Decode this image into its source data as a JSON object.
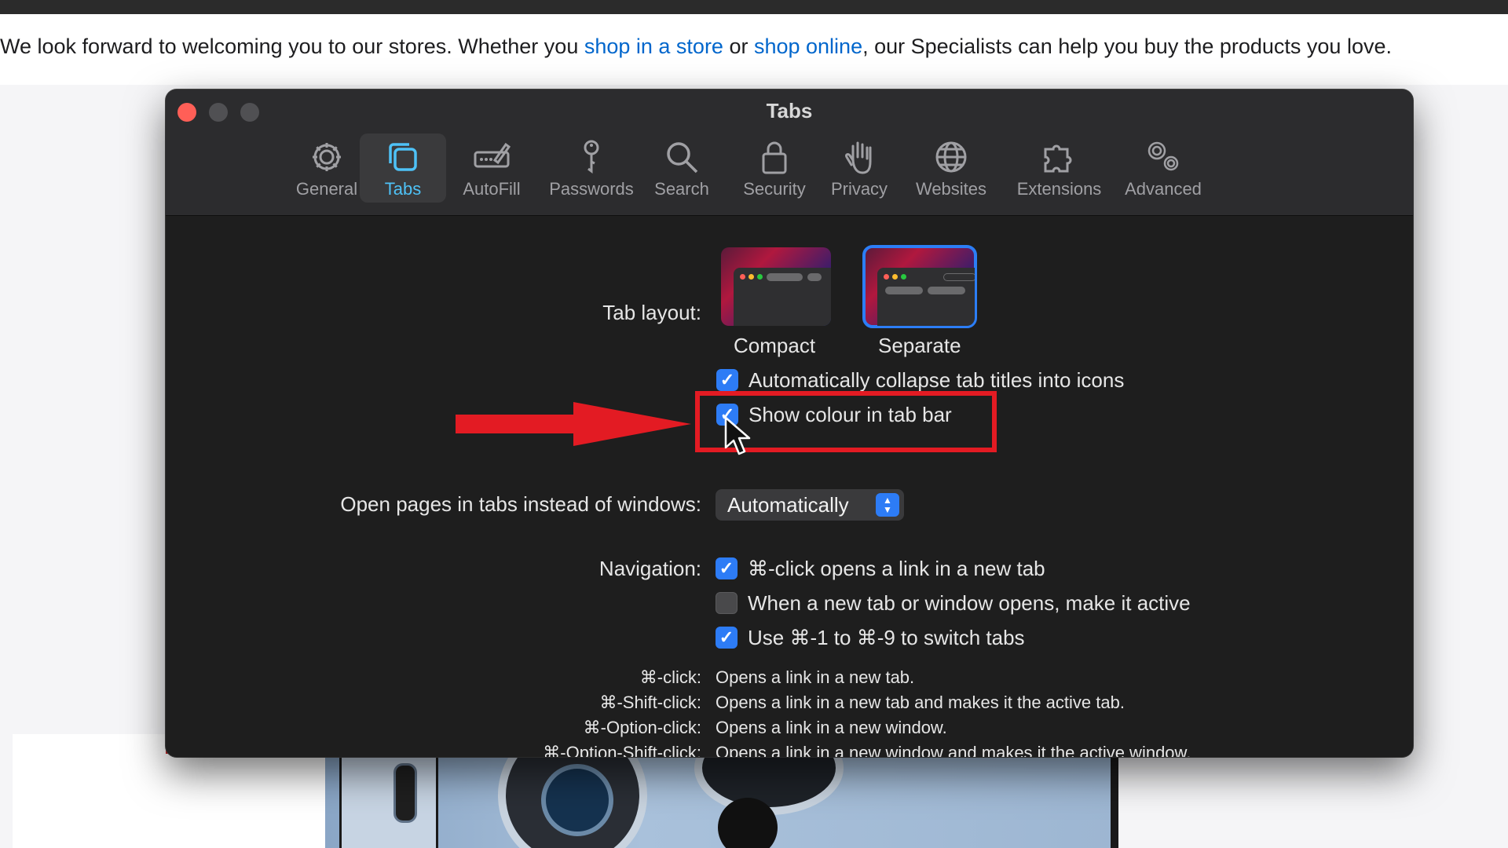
{
  "banner": {
    "prefix": "We look forward to welcoming you to our stores. Whether you ",
    "link1": "shop in a store",
    "middle": " or ",
    "link2": "shop online",
    "suffix": ", our Specialists can help you buy the products you love."
  },
  "window": {
    "title": "Tabs",
    "toolbar": [
      {
        "label": "General",
        "icon": "gear-icon"
      },
      {
        "label": "Tabs",
        "icon": "tabs-icon",
        "active": true
      },
      {
        "label": "AutoFill",
        "icon": "autofill-icon"
      },
      {
        "label": "Passwords",
        "icon": "key-icon"
      },
      {
        "label": "Search",
        "icon": "search-icon"
      },
      {
        "label": "Security",
        "icon": "lock-icon"
      },
      {
        "label": "Privacy",
        "icon": "hand-icon"
      },
      {
        "label": "Websites",
        "icon": "globe-icon"
      },
      {
        "label": "Extensions",
        "icon": "puzzle-icon"
      },
      {
        "label": "Advanced",
        "icon": "gears-icon"
      }
    ]
  },
  "tabs_settings": {
    "tab_layout_label": "Tab layout:",
    "layout_compact": "Compact",
    "layout_separate": "Separate",
    "layout_selected": "Separate",
    "collapse_titles": {
      "label": "Automatically collapse tab titles into icons",
      "checked": true
    },
    "show_colour": {
      "label": "Show colour in tab bar",
      "checked": true
    },
    "open_pages_label": "Open pages in tabs instead of windows:",
    "open_pages_value": "Automatically",
    "navigation_label": "Navigation:",
    "nav_cmd_click": {
      "label": "⌘-click opens a link in a new tab",
      "checked": true
    },
    "nav_make_active": {
      "label": "When a new tab or window opens, make it active",
      "checked": false
    },
    "nav_switch_tabs": {
      "label": "Use ⌘-1 to ⌘-9 to switch tabs",
      "checked": true
    },
    "shortcuts": [
      {
        "key": "⌘-click:",
        "desc": "Opens a link in a new tab."
      },
      {
        "key": "⌘-Shift-click:",
        "desc": "Opens a link in a new tab and makes it the active tab."
      },
      {
        "key": "⌘-Option-click:",
        "desc": "Opens a link in a new window."
      },
      {
        "key": "⌘-Option-Shift-click:",
        "desc": "Opens a link in a new window and makes it the active window."
      }
    ],
    "help": "?"
  },
  "colors": {
    "accent": "#2d7cf6",
    "active_tab": "#4ec2f7",
    "annotation_red": "#e31b23"
  }
}
